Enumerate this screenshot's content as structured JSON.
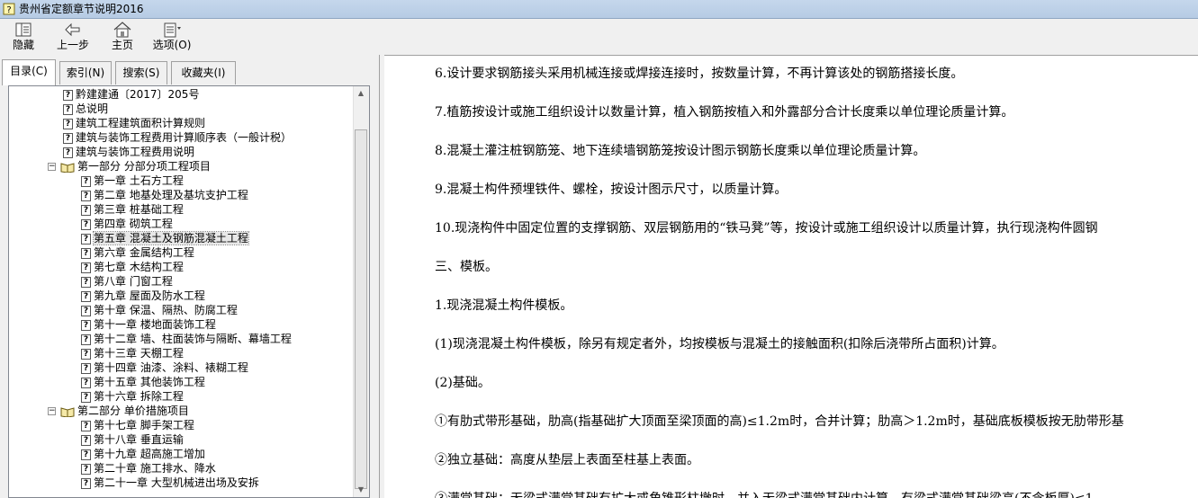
{
  "window": {
    "title": "贵州省定额章节说明2016"
  },
  "toolbar": {
    "hide_label": "隐藏",
    "back_label": "上一步",
    "home_label": "主页",
    "options_label": "选项(O)"
  },
  "tabs": [
    "目录(C)",
    "索引(N)",
    "搜索(S)",
    "收藏夹(I)"
  ],
  "tree": [
    "黔建建通〔2017〕205号",
    "总说明",
    "建筑工程建筑面积计算规则",
    "建筑与装饰工程费用计算顺序表（一般计税）",
    "建筑与装饰工程费用说明",
    "第一部分 分部分项工程项目",
    "第一章 土石方工程",
    "第二章 地基处理及基坑支护工程",
    "第三章 桩基础工程",
    "第四章 砌筑工程",
    "第五章 混凝土及钢筋混凝土工程",
    "第六章 金属结构工程",
    "第七章 木结构工程",
    "第八章 门窗工程",
    "第九章 屋面及防水工程",
    "第十章 保温、隔热、防腐工程",
    "第十一章 楼地面装饰工程",
    "第十二章 墙、柱面装饰与隔断、幕墙工程",
    "第十三章 天棚工程",
    "第十四章 油漆、涂料、裱糊工程",
    "第十五章 其他装饰工程",
    "第十六章 拆除工程",
    "第二部分 单价措施项目",
    "第十七章 脚手架工程",
    "第十八章 垂直运输",
    "第十九章 超高施工增加",
    "第二十章 施工排水、降水",
    "第二十一章 大型机械进出场及安拆"
  ],
  "content": [
    "6.设计要求钢筋接头采用机械连接或焊接连接时，按数量计算，不再计算该处的钢筋搭接长度。",
    "7.植筋按设计或施工组织设计以数量计算，植入钢筋按植入和外露部分合计长度乘以单位理论质量计算。",
    "8.混凝土灌注桩钢筋笼、地下连续墙钢筋笼按设计图示钢筋长度乘以单位理论质量计算。",
    "9.混凝土构件预埋铁件、螺栓，按设计图示尺寸，以质量计算。",
    "10.现浇构件中固定位置的支撑钢筋、双层钢筋用的“铁马凳”等，按设计或施工组织设计以质量计算，执行现浇构件圆钢",
    "三、模板。",
    "1.现浇混凝土构件模板。",
    "(1)现浇混凝土构件模板，除另有规定者外，均按模板与混凝土的接触面积(扣除后浇带所占面积)计算。",
    "(2)基础。",
    "①有肋式带形基础，肋高(指基础扩大顶面至梁顶面的高)≤1.2m时，合并计算；肋高＞1.2m时，基础底板模板按无肋带形基",
    "②独立基础：高度从垫层上表面至柱基上表面。",
    "③满堂基础：无梁式满堂基础有扩大或角锥形柱墩时，并入无梁式满堂基础内计算。有梁式满堂基础梁高(不含板厚)≤1"
  ]
}
